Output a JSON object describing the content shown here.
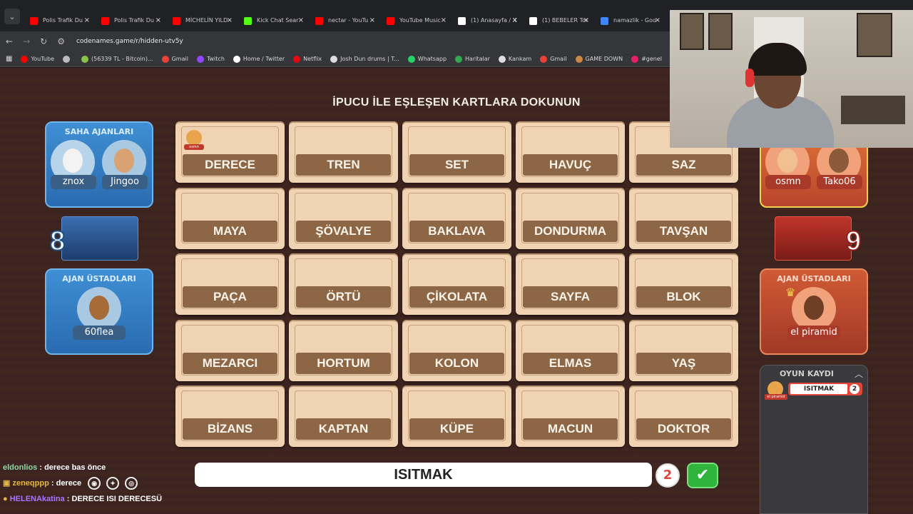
{
  "browser": {
    "tabs": [
      {
        "title": "Polis Trafik Du",
        "color": "#ff0000"
      },
      {
        "title": "Polis Trafik Du",
        "color": "#ff0000"
      },
      {
        "title": "MİCHELİN YILD",
        "color": "#ff0000"
      },
      {
        "title": "Kick Chat Sear",
        "color": "#53fc18"
      },
      {
        "title": "nectar - YouTu",
        "color": "#ff0000"
      },
      {
        "title": "YouTube Music",
        "color": "#ff0000"
      },
      {
        "title": "(1) Anasayfa / X",
        "color": "#ffffff"
      },
      {
        "title": "(1) BEBELER Tor",
        "color": "#ffffff"
      },
      {
        "title": "namazlik - Goo",
        "color": "#4285f4"
      }
    ],
    "url": "codenames.game/r/hidden-utv5y",
    "bookmarks": [
      {
        "label": "YouTube",
        "color": "#ff0000"
      },
      {
        "label": "",
        "color": "#bbbbbb"
      },
      {
        "label": "(56339 TL - Bitcoin)...",
        "color": "#8bc34a"
      },
      {
        "label": "Gmail",
        "color": "#ea4335"
      },
      {
        "label": "Twitch",
        "color": "#9146ff"
      },
      {
        "label": "Home / Twitter",
        "color": "#ffffff"
      },
      {
        "label": "Netflix",
        "color": "#e50914"
      },
      {
        "label": "Josh Dun drums | T...",
        "color": "#dddddd"
      },
      {
        "label": "Whatsapp",
        "color": "#25d366"
      },
      {
        "label": "Haritalar",
        "color": "#34a853"
      },
      {
        "label": "Kankam",
        "color": "#dddddd"
      },
      {
        "label": "Gmail",
        "color": "#ea4335"
      },
      {
        "label": "GAME DOWN",
        "color": "#cc8844"
      },
      {
        "label": "#genel",
        "color": "#e91e63"
      },
      {
        "label": "Binance",
        "color": "#dddddd"
      }
    ]
  },
  "game": {
    "instruction": "İPUCU İLE EŞLEŞEN KARTLARA DOKUNUN",
    "cards": [
      {
        "word": "DERECE",
        "marker": "osmn"
      },
      {
        "word": "TREN"
      },
      {
        "word": "SET"
      },
      {
        "word": "HAVUÇ"
      },
      {
        "word": "SAZ"
      },
      {
        "word": "MAYA"
      },
      {
        "word": "ŞÖVALYE"
      },
      {
        "word": "BAKLAVA"
      },
      {
        "word": "DONDURMA"
      },
      {
        "word": "TAVŞAN"
      },
      {
        "word": "PAÇA"
      },
      {
        "word": "ÖRTÜ"
      },
      {
        "word": "ÇİKOLATA"
      },
      {
        "word": "SAYFA"
      },
      {
        "word": "BLOK"
      },
      {
        "word": "MEZARCI"
      },
      {
        "word": "HORTUM"
      },
      {
        "word": "KOLON"
      },
      {
        "word": "ELMAS"
      },
      {
        "word": "YAŞ"
      },
      {
        "word": "BİZANS"
      },
      {
        "word": "KAPTAN"
      },
      {
        "word": "KÜPE"
      },
      {
        "word": "MACUN"
      },
      {
        "word": "DOKTOR"
      }
    ],
    "blue_team": {
      "operatives_title": "SAHA AJANLARI",
      "operatives": [
        "znox",
        "Jingoo"
      ],
      "score": "8",
      "spymasters_title": "AJAN ÜSTADLARI",
      "spymasters": [
        "60flea"
      ],
      "color": "#2f77c2"
    },
    "red_team": {
      "operatives": [
        "osmn",
        "Tako06"
      ],
      "score": "9",
      "spymasters_title": "AJAN ÜSTADLARI",
      "spymasters": [
        "el piramid"
      ],
      "color": "#c9432f"
    },
    "log": {
      "title": "OYUN KAYDI",
      "entries": [
        {
          "player": "el piramid",
          "clue": "ISITMAK",
          "number": "2"
        }
      ]
    },
    "clue_bar": {
      "word": "ISITMAK",
      "number": "2",
      "confirm": "✔"
    }
  },
  "chat": [
    {
      "user": "eldonlios",
      "message": "derece bas önce"
    },
    {
      "user": "zeneqppp",
      "message": "derece"
    },
    {
      "user": "HELENAkatina",
      "message": "DERECE ISI DERECESÜ"
    }
  ]
}
